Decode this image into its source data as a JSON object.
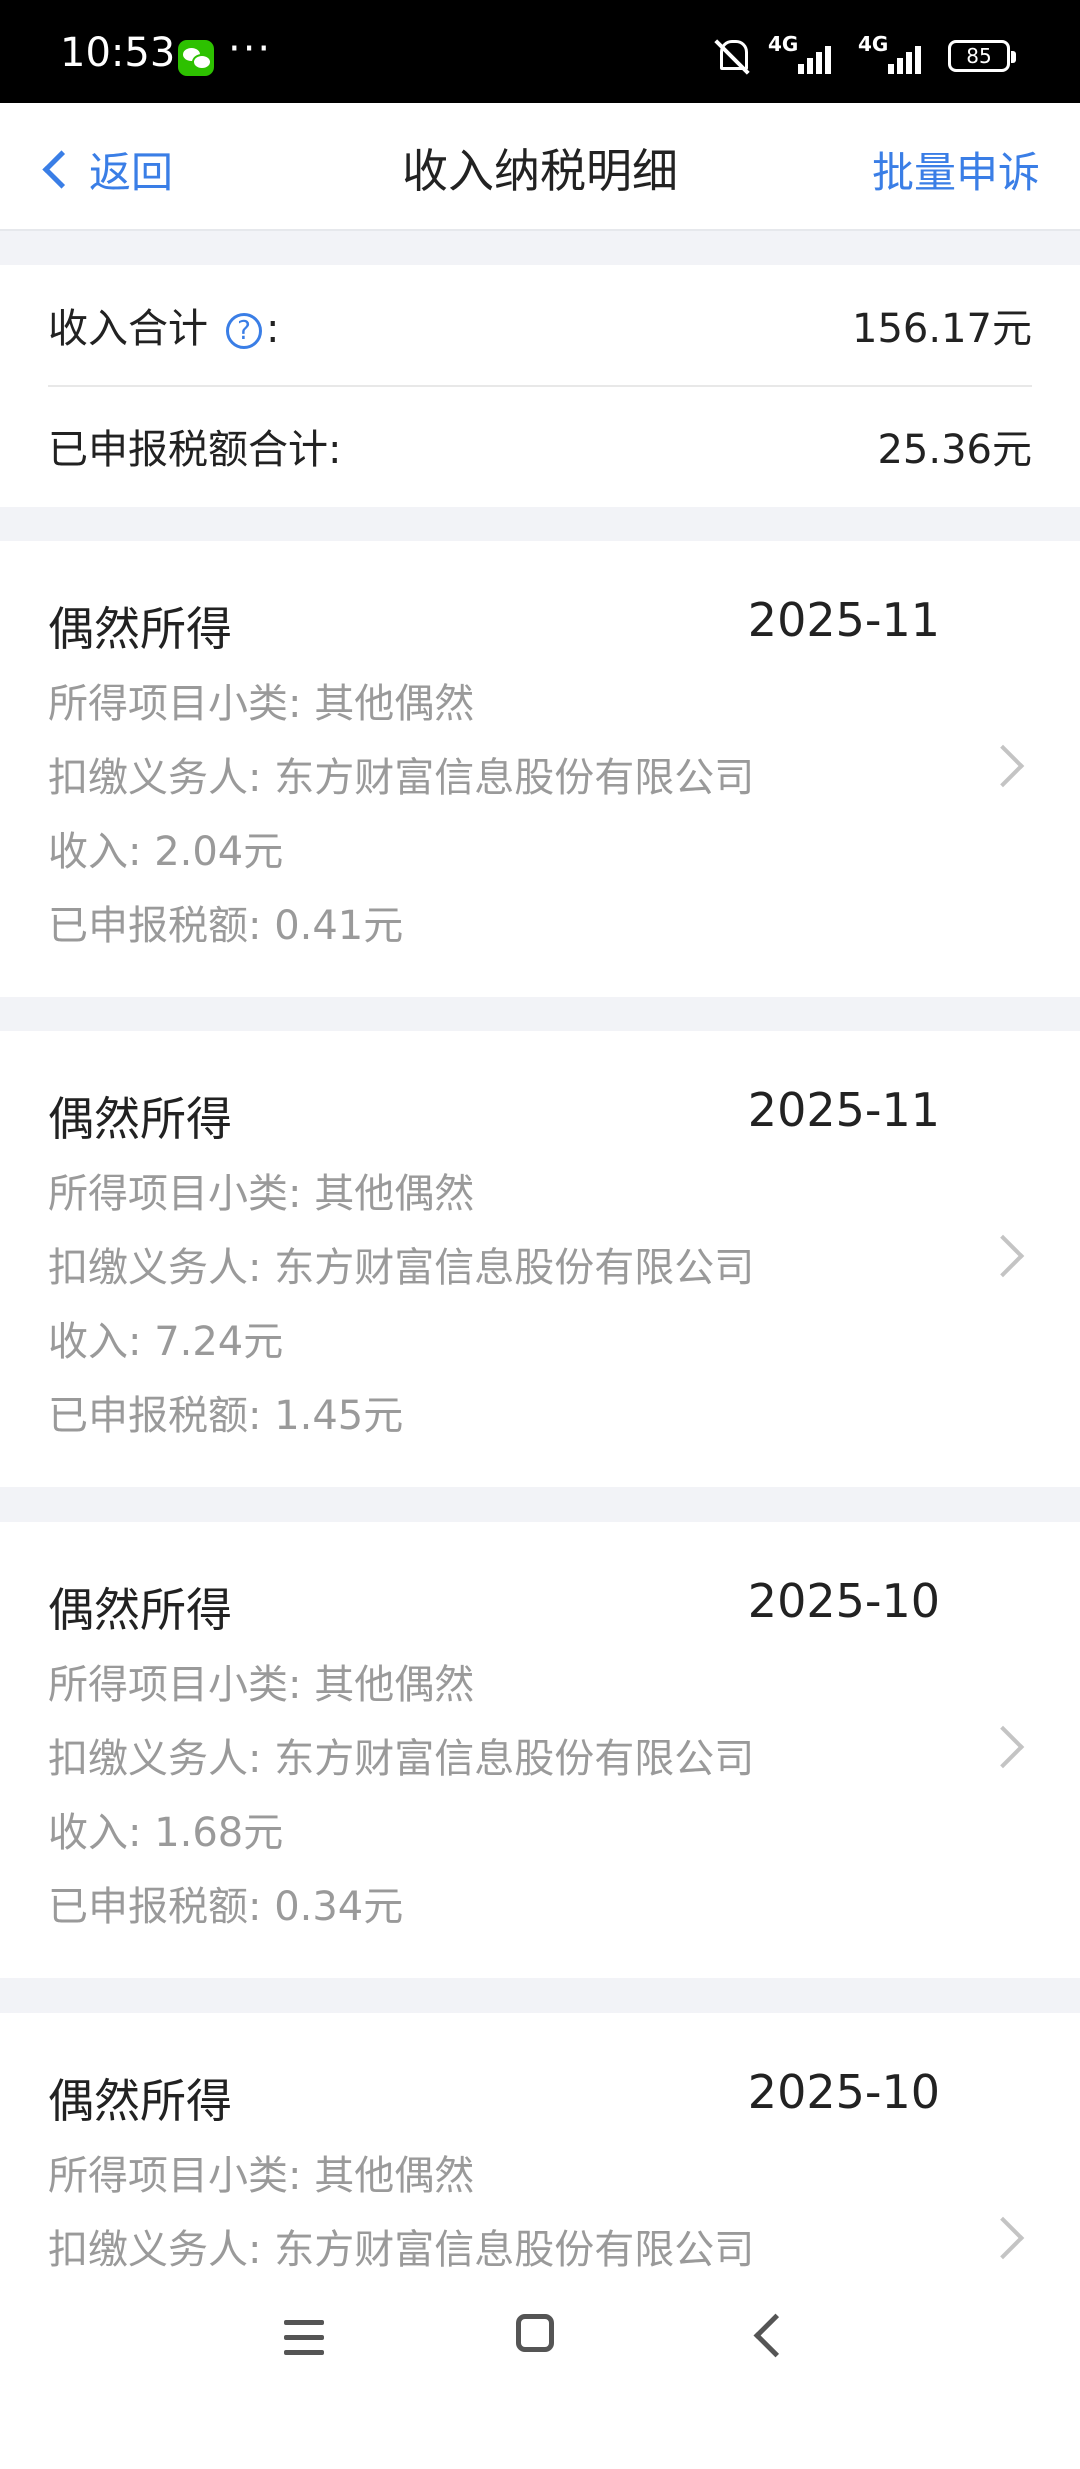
{
  "status_bar": {
    "time": "10:53",
    "dots": "···",
    "signal1": "4G",
    "signal2": "4G",
    "battery": "85"
  },
  "nav": {
    "back_label": "返回",
    "title": "收入纳税明细",
    "action_label": "批量申诉"
  },
  "summary": {
    "income_label": "收入合计",
    "income_colon": ":",
    "income_value": "156.17元",
    "tax_label": "已申报税额合计:",
    "tax_value": "25.36元"
  },
  "records": [
    {
      "type": "偶然所得",
      "date": "2025-11",
      "subcategory": "所得项目小类: 其他偶然",
      "withholder": "扣缴义务人: 东方财富信息股份有限公司",
      "income": "收入: 2.04元",
      "tax": "已申报税额: 0.41元"
    },
    {
      "type": "偶然所得",
      "date": "2025-11",
      "subcategory": "所得项目小类: 其他偶然",
      "withholder": "扣缴义务人: 东方财富信息股份有限公司",
      "income": "收入: 7.24元",
      "tax": "已申报税额: 1.45元"
    },
    {
      "type": "偶然所得",
      "date": "2025-10",
      "subcategory": "所得项目小类: 其他偶然",
      "withholder": "扣缴义务人: 东方财富信息股份有限公司",
      "income": "收入: 1.68元",
      "tax": "已申报税额: 0.34元"
    },
    {
      "type": "偶然所得",
      "date": "2025-10",
      "subcategory": "所得项目小类: 其他偶然",
      "withholder": "扣缴义务人: 东方财富信息股份有限公司",
      "income": "",
      "tax": ""
    }
  ],
  "icons": {
    "help": "help-circle-icon",
    "chevron": "chevron-right-icon"
  },
  "colors": {
    "accent": "#3a7ee6",
    "secondary_text": "#9a9a9a",
    "background": "#f2f3f7"
  }
}
